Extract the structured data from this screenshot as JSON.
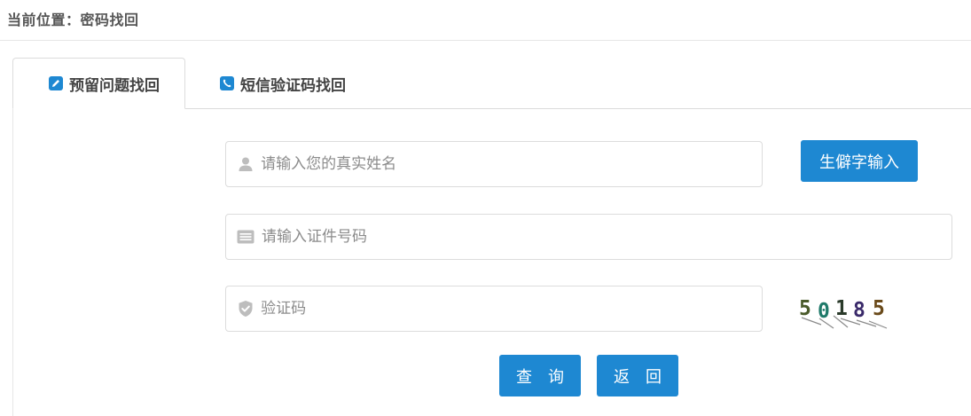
{
  "breadcrumb": "当前位置：密码找回",
  "tabs": [
    {
      "label": "预留问题找回",
      "icon": "edit-icon",
      "active": true
    },
    {
      "label": "短信验证码找回",
      "icon": "phone-icon",
      "active": false
    }
  ],
  "form": {
    "name_placeholder": "请输入您的真实姓名",
    "id_placeholder": "请输入证件号码",
    "captcha_placeholder": "验证码",
    "rare_char_button": "生僻字输入",
    "captcha_text": [
      "5",
      "0",
      "1",
      "8",
      "5"
    ]
  },
  "actions": {
    "query_label": "查　询",
    "back_label": "返　回"
  },
  "colors": {
    "accent": "#1e88d2",
    "icon_gray": "#bdbdbd"
  }
}
